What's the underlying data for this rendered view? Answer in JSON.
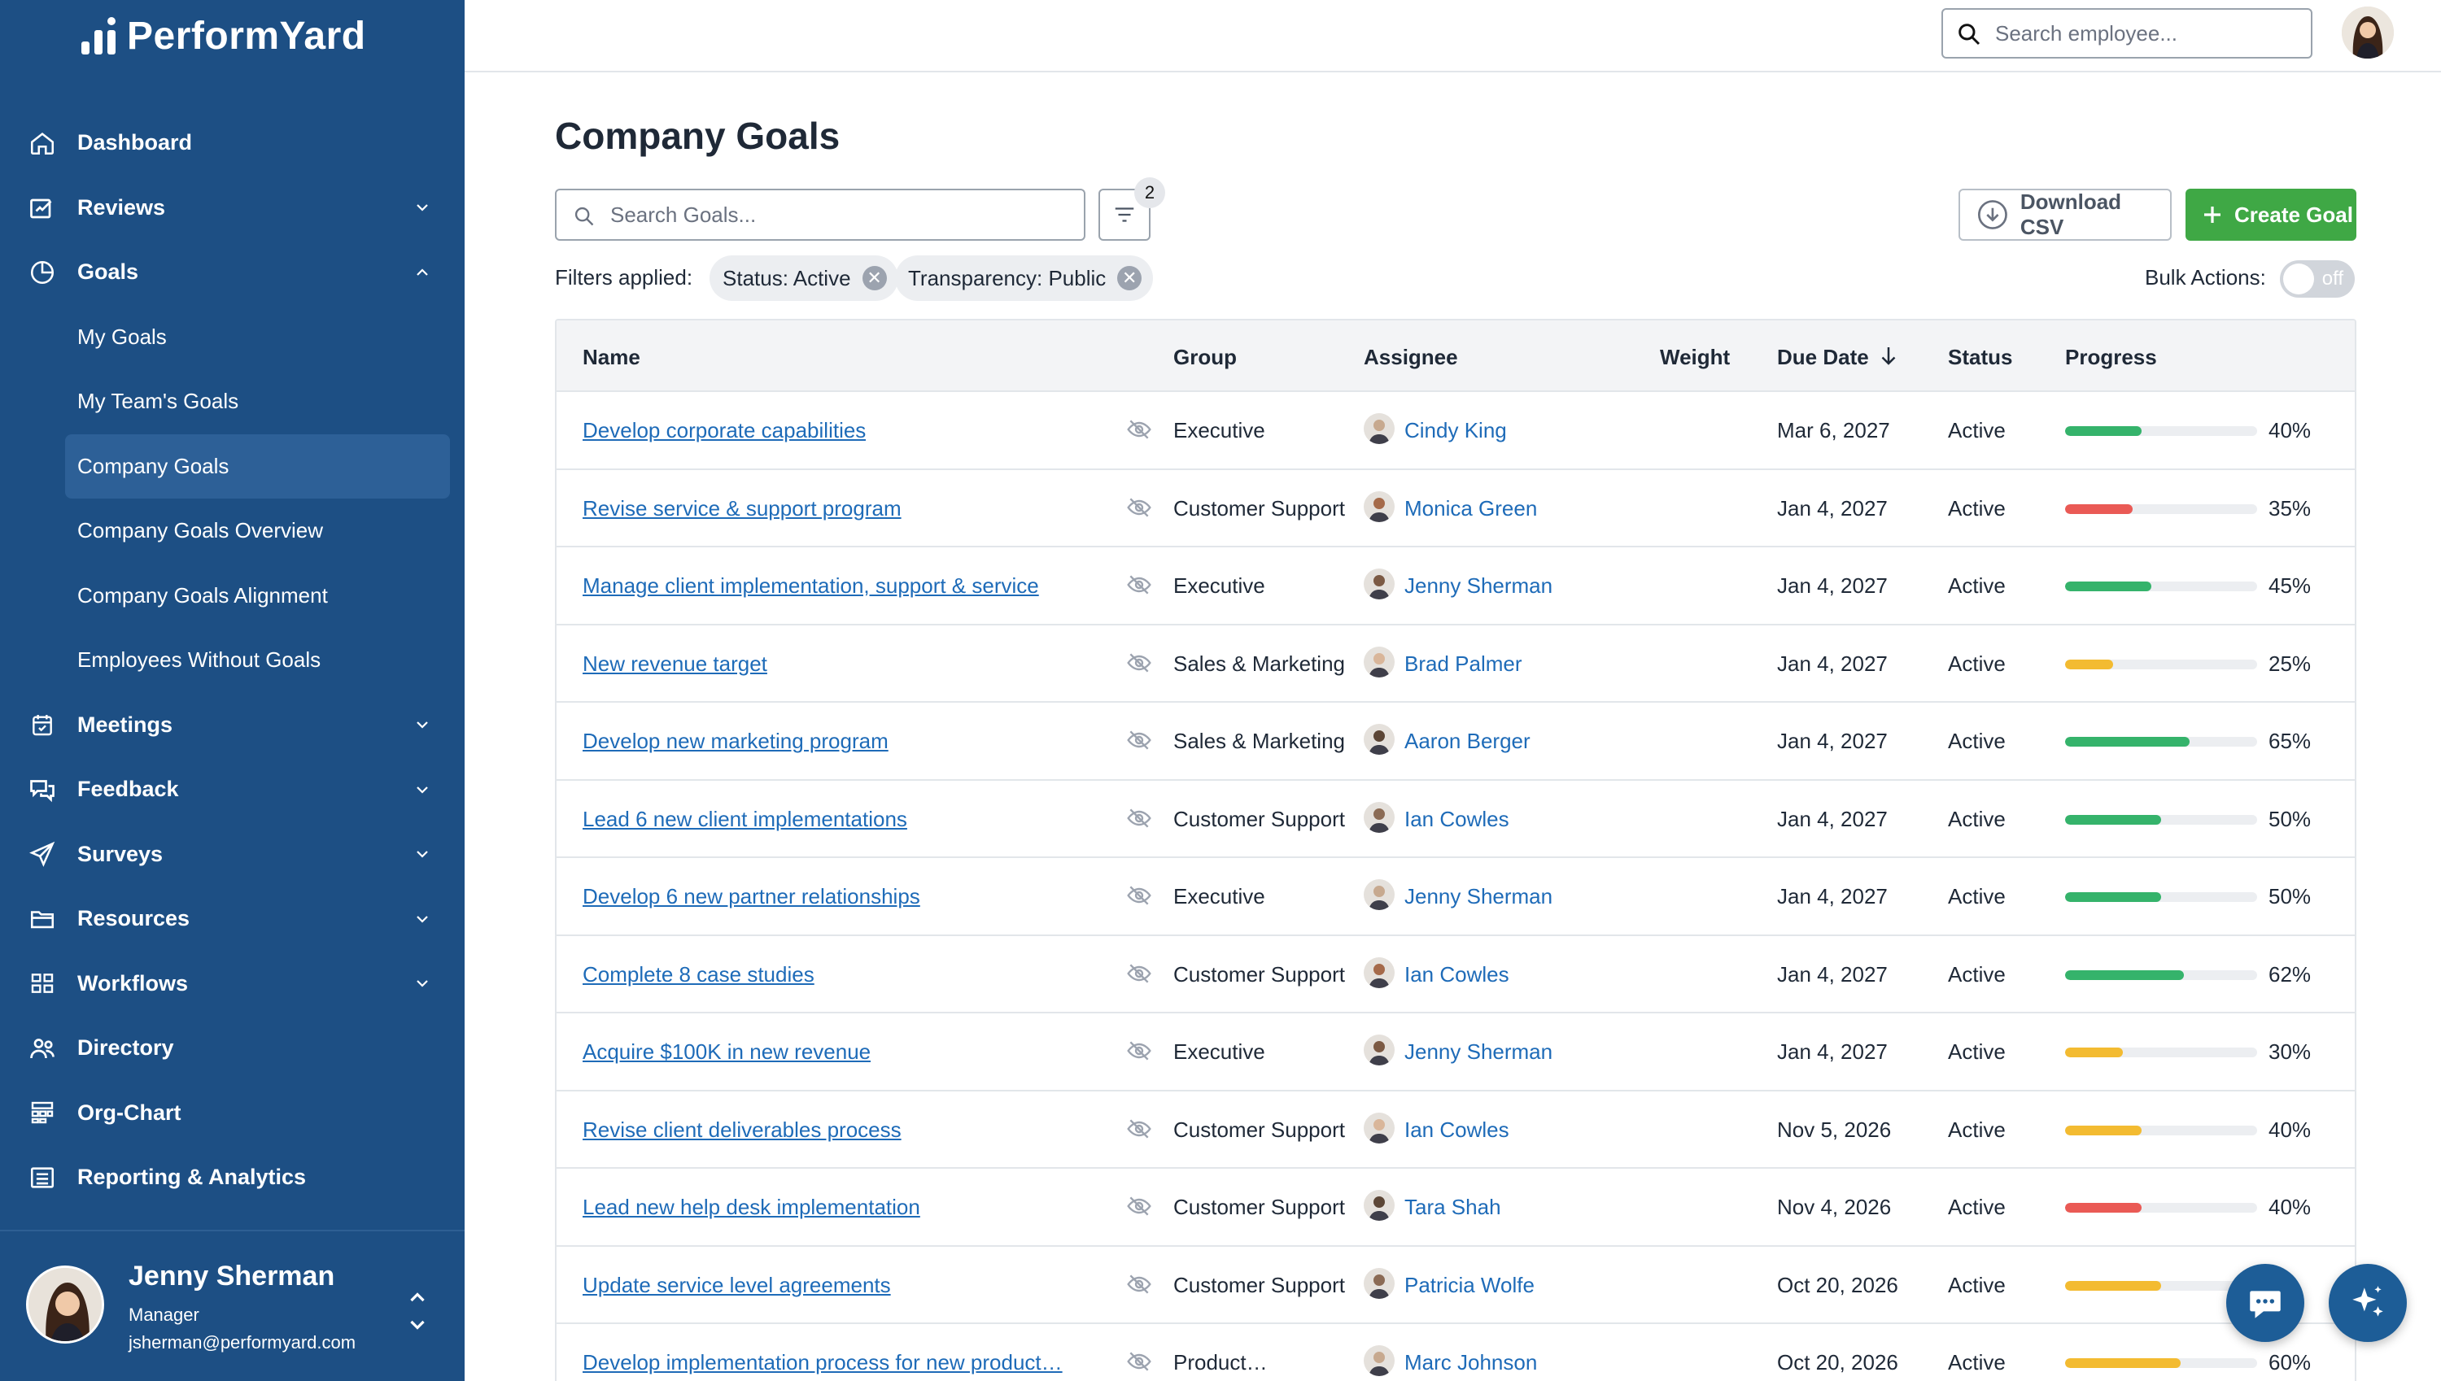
{
  "brand": {
    "name": "PerformYard"
  },
  "colors": {
    "sidebar": "#1d4f84",
    "accent_green": "#3fa845",
    "link": "#1e6bb8",
    "bar_green": "#35b36b",
    "bar_red": "#ea5a55",
    "bar_yellow": "#f3bb31"
  },
  "nav": {
    "items": [
      {
        "label": "Dashboard",
        "icon": "home-icon"
      },
      {
        "label": "Reviews",
        "icon": "reviews-icon",
        "chevron": "down"
      },
      {
        "label": "Goals",
        "icon": "goals-icon",
        "chevron": "up"
      }
    ],
    "goals_sub": [
      {
        "label": "My Goals"
      },
      {
        "label": "My Team's Goals"
      },
      {
        "label": "Company Goals",
        "active": true
      },
      {
        "label": "Company Goals Overview"
      },
      {
        "label": "Company Goals Alignment"
      },
      {
        "label": "Employees Without Goals"
      }
    ],
    "items_after": [
      {
        "label": "Meetings",
        "icon": "calendar-icon",
        "chevron": "down"
      },
      {
        "label": "Feedback",
        "icon": "feedback-icon",
        "chevron": "down"
      },
      {
        "label": "Surveys",
        "icon": "send-icon",
        "chevron": "down"
      },
      {
        "label": "Resources",
        "icon": "folder-icon",
        "chevron": "down"
      },
      {
        "label": "Workflows",
        "icon": "workflow-icon",
        "chevron": "down"
      },
      {
        "label": "Directory",
        "icon": "people-icon"
      },
      {
        "label": "Org-Chart",
        "icon": "org-chart-icon"
      },
      {
        "label": "Reporting & Analytics",
        "icon": "report-icon"
      }
    ]
  },
  "profile": {
    "name": "Jenny Sherman",
    "role": "Manager",
    "email": "jsherman@performyard.com"
  },
  "topbar": {
    "search_placeholder": "Search employee..."
  },
  "main": {
    "title": "Company Goals",
    "search_placeholder": "Search Goals...",
    "filter_count": "2",
    "download_label": "Download CSV",
    "create_label": "Create Goal",
    "filters_label": "Filters applied:",
    "chips": [
      "Status: Active",
      "Transparency: Public"
    ],
    "bulk_label": "Bulk Actions:",
    "toggle_label": "off"
  },
  "table": {
    "headers": {
      "name": "Name",
      "group": "Group",
      "assignee": "Assignee",
      "weight": "Weight",
      "due": "Due Date",
      "status": "Status",
      "progress": "Progress"
    },
    "rows": [
      {
        "name": "Develop corporate capabilities",
        "group": "Executive",
        "assignee": "Cindy King",
        "due": "Mar 6, 2027",
        "status": "Active",
        "progress": 40,
        "pct": "40%",
        "color": "green"
      },
      {
        "name": "Revise service & support program",
        "group": "Customer Support",
        "assignee": "Monica Green",
        "due": "Jan 4, 2027",
        "status": "Active",
        "progress": 35,
        "pct": "35%",
        "color": "red"
      },
      {
        "name": "Manage client implementation, support & service",
        "group": "Executive",
        "assignee": "Jenny Sherman",
        "due": "Jan 4, 2027",
        "status": "Active",
        "progress": 45,
        "pct": "45%",
        "color": "green"
      },
      {
        "name": "New revenue target",
        "group": "Sales & Marketing",
        "assignee": "Brad Palmer",
        "due": "Jan 4, 2027",
        "status": "Active",
        "progress": 25,
        "pct": "25%",
        "color": "yellow"
      },
      {
        "name": "Develop new marketing program",
        "group": "Sales & Marketing",
        "assignee": "Aaron Berger",
        "due": "Jan 4, 2027",
        "status": "Active",
        "progress": 65,
        "pct": "65%",
        "color": "green"
      },
      {
        "name": "Lead 6 new client implementations",
        "group": "Customer Support",
        "assignee": "Ian Cowles",
        "due": "Jan 4, 2027",
        "status": "Active",
        "progress": 50,
        "pct": "50%",
        "color": "green"
      },
      {
        "name": "Develop 6 new partner relationships",
        "group": "Executive",
        "assignee": "Jenny Sherman",
        "due": "Jan 4, 2027",
        "status": "Active",
        "progress": 50,
        "pct": "50%",
        "color": "green"
      },
      {
        "name": "Complete 8 case studies",
        "group": "Customer Support",
        "assignee": "Ian Cowles",
        "due": "Jan 4, 2027",
        "status": "Active",
        "progress": 62,
        "pct": "62%",
        "color": "green"
      },
      {
        "name": "Acquire $100K in new revenue",
        "group": "Executive",
        "assignee": "Jenny Sherman",
        "due": "Jan 4, 2027",
        "status": "Active",
        "progress": 30,
        "pct": "30%",
        "color": "yellow"
      },
      {
        "name": "Revise client deliverables process",
        "group": "Customer Support",
        "assignee": "Ian Cowles",
        "due": "Nov 5, 2026",
        "status": "Active",
        "progress": 40,
        "pct": "40%",
        "color": "yellow"
      },
      {
        "name": "Lead new help desk implementation",
        "group": "Customer Support",
        "assignee": "Tara Shah",
        "due": "Nov 4, 2026",
        "status": "Active",
        "progress": 40,
        "pct": "40%",
        "color": "red"
      },
      {
        "name": "Update service level agreements",
        "group": "Customer Support",
        "assignee": "Patricia Wolfe",
        "due": "Oct 20, 2026",
        "status": "Active",
        "progress": 50,
        "pct": "",
        "color": "yellow"
      },
      {
        "name": "Develop implementation process for new product…",
        "group": "Product…",
        "assignee": "Marc Johnson",
        "due": "Oct 20, 2026",
        "status": "Active",
        "progress": 60,
        "pct": "60%",
        "color": "yellow"
      }
    ]
  }
}
